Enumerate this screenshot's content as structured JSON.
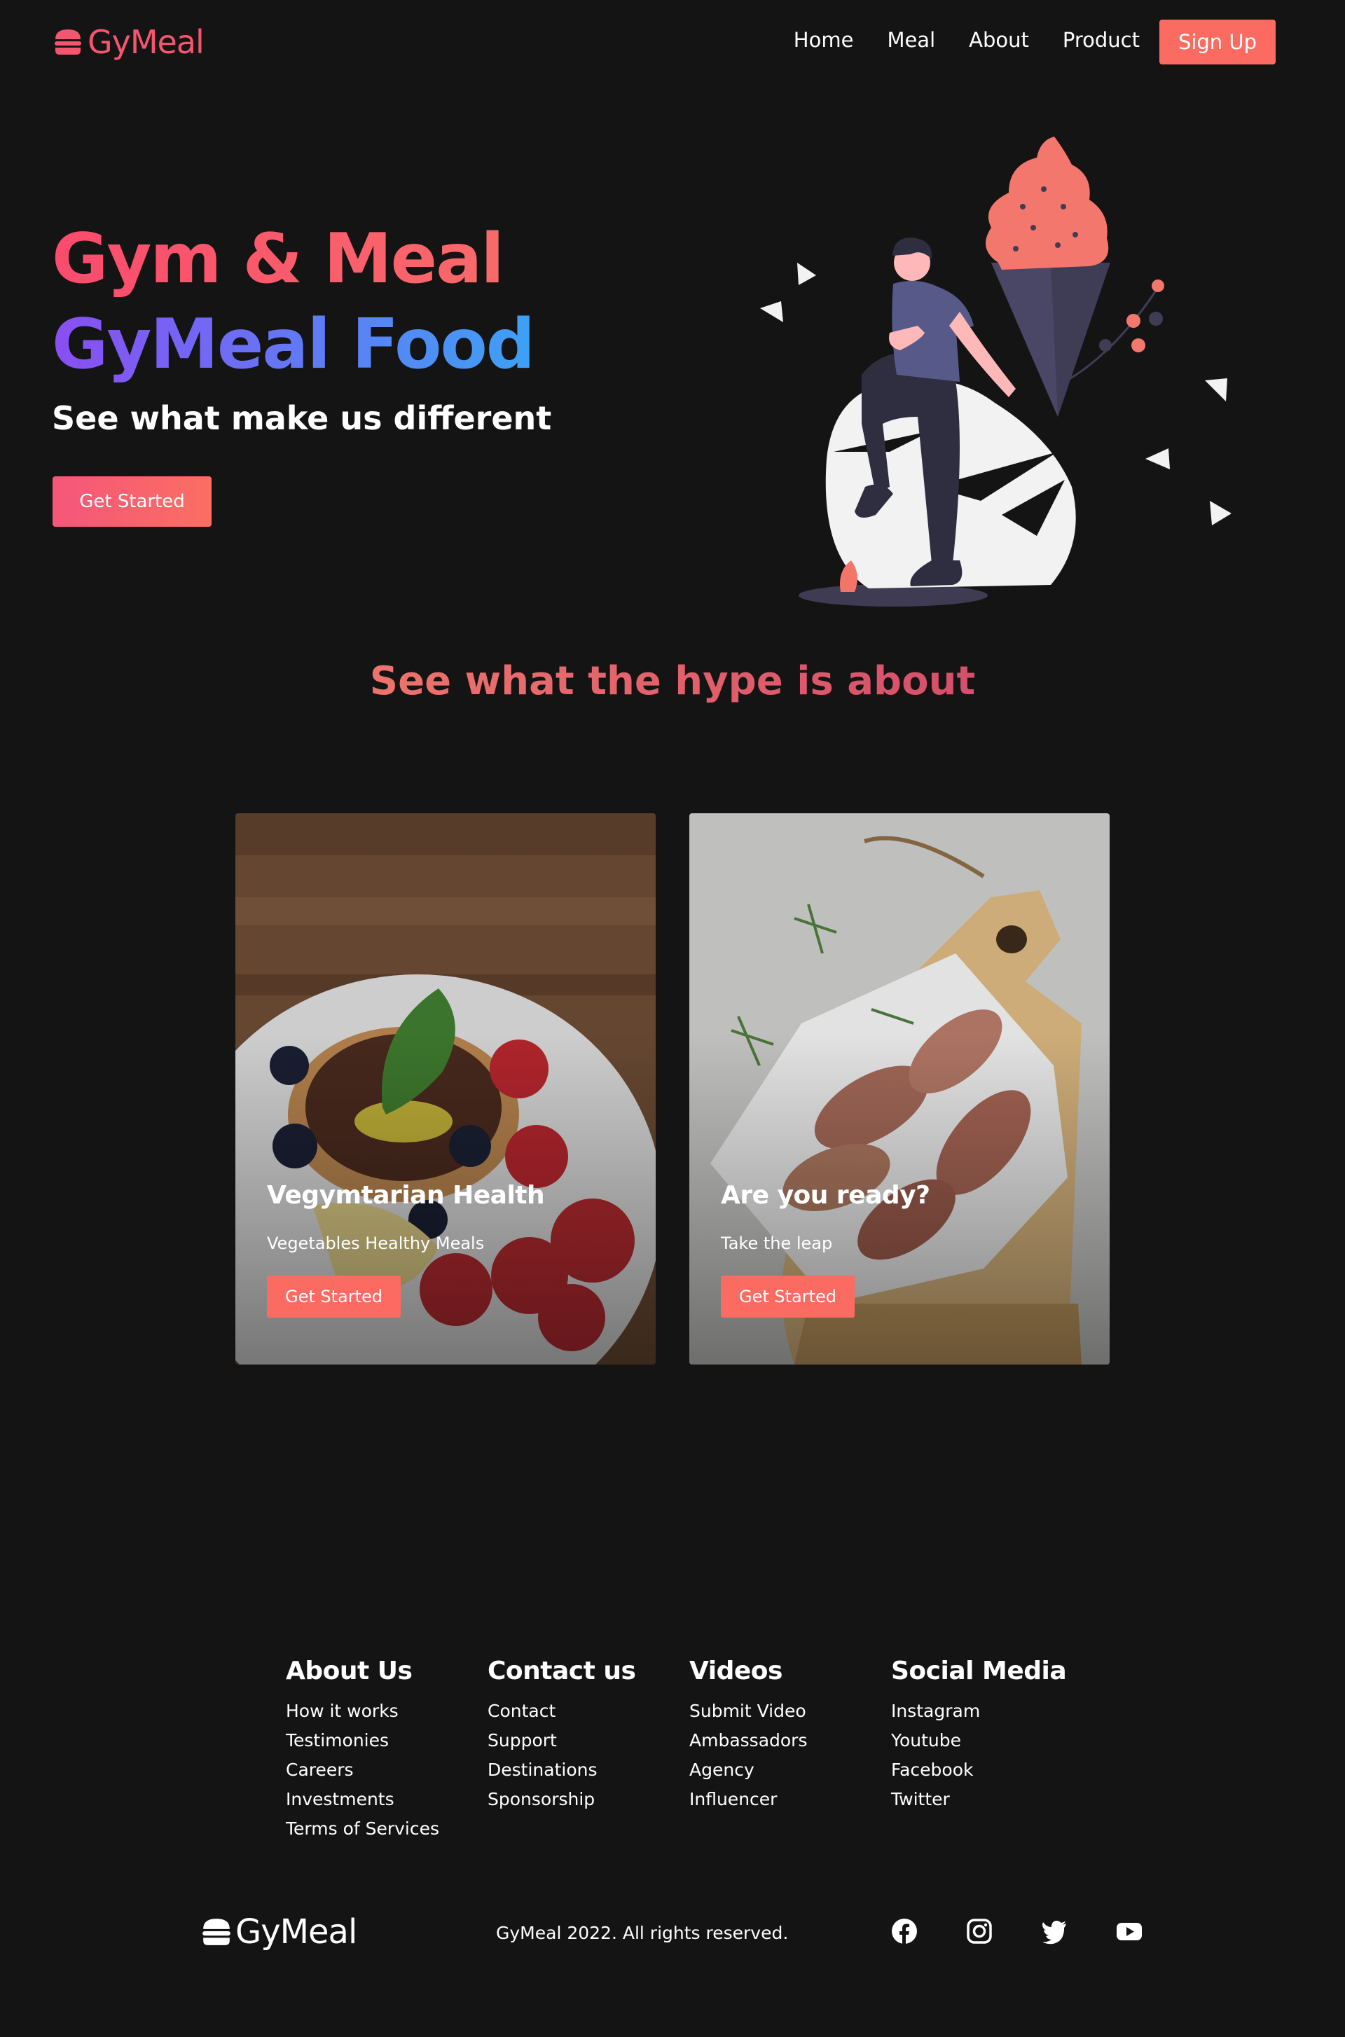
{
  "brand": {
    "name": "GyMeal",
    "accent": "#fb6b62"
  },
  "nav": {
    "links": [
      "Home",
      "Meal",
      "About",
      "Product"
    ],
    "signup": "Sign Up"
  },
  "hero": {
    "title1": "Gym & Meal",
    "title2": "GyMeal Food",
    "subtitle": "See what make us different",
    "button": "Get Started"
  },
  "hype": {
    "heading": "See what the hype is about"
  },
  "cards": [
    {
      "title": "Vegymtarian Health",
      "subtitle": "Vegetables Healthy Meals",
      "button": "Get Started"
    },
    {
      "title": "Are you ready?",
      "subtitle": "Take the leap",
      "button": "Get Started"
    }
  ],
  "footer": {
    "columns": [
      {
        "title": "About Us",
        "links": [
          "How it works",
          "Testimonies",
          "Careers",
          "Investments",
          "Terms of Services"
        ]
      },
      {
        "title": "Contact us",
        "links": [
          "Contact",
          "Support",
          "Destinations",
          "Sponsorship"
        ]
      },
      {
        "title": "Videos",
        "links": [
          "Submit Video",
          "Ambassadors",
          "Agency",
          "Influencer"
        ]
      },
      {
        "title": "Social Media",
        "links": [
          "Instagram",
          "Youtube",
          "Facebook",
          "Twitter"
        ]
      }
    ],
    "copyright": "GyMeal 2022. All rights reserved.",
    "social_icons": [
      "facebook-icon",
      "instagram-icon",
      "twitter-icon",
      "youtube-icon"
    ]
  }
}
